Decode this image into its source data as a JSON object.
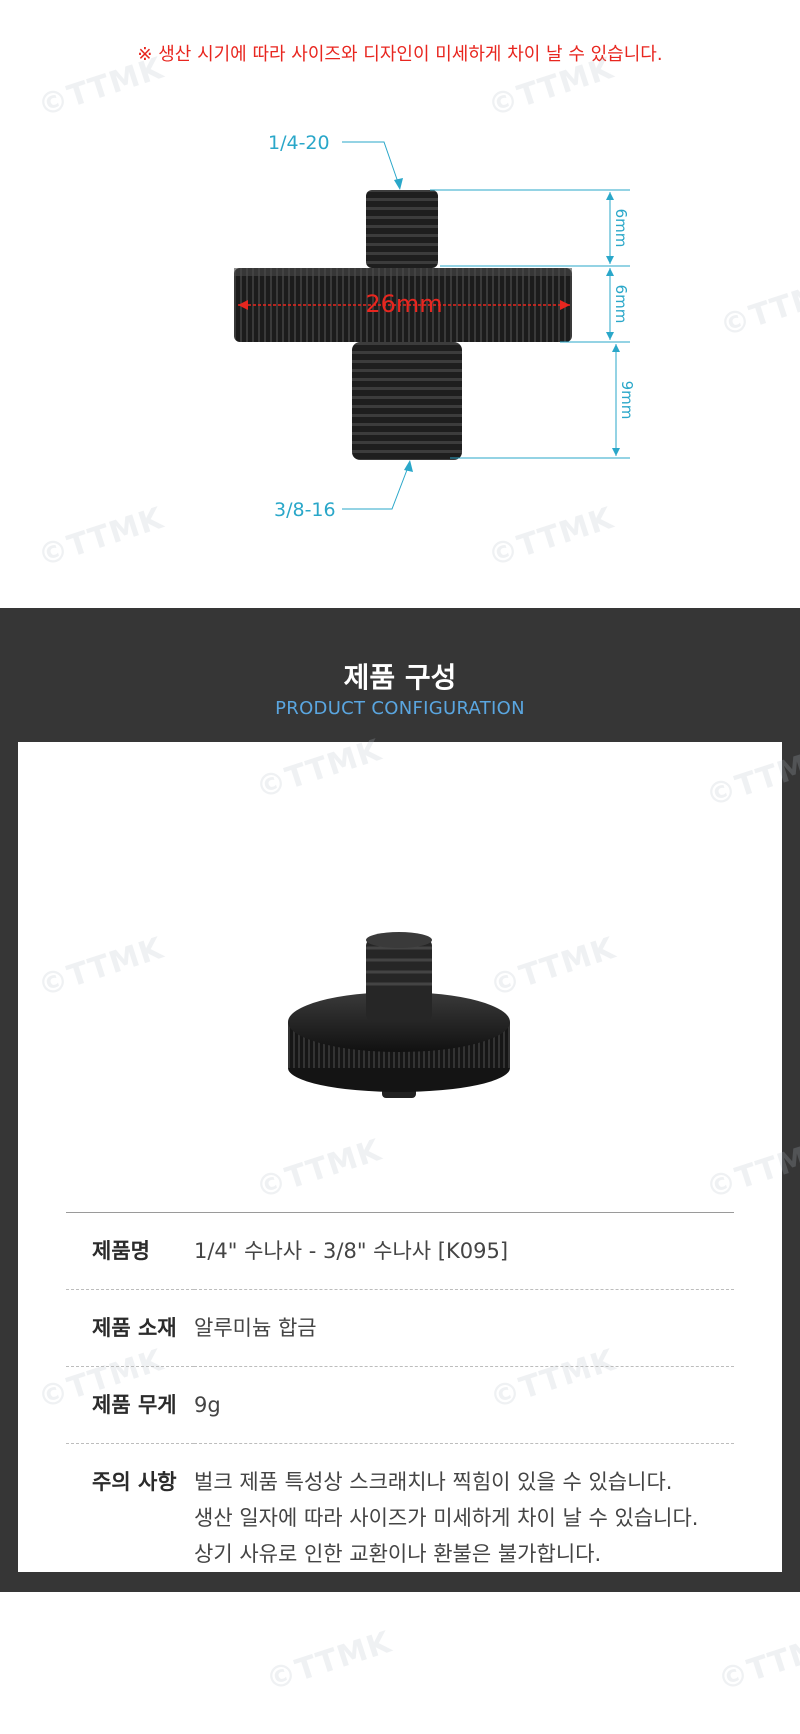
{
  "notice": "※ 생산 시기에 따라 사이즈와 디자인이 미세하게 차이 날 수 있습니다.",
  "watermark": "©TTMK",
  "diagram": {
    "top_thread": "1/4-20",
    "bottom_thread": "3/8-16",
    "diameter": "26mm",
    "dim_top": "6mm",
    "dim_middle": "6mm",
    "dim_bottom": "9mm",
    "accent_color": "#2aa7c9",
    "diameter_color": "#e8261f"
  },
  "section": {
    "title": "제품 구성",
    "subtitle": "PRODUCT CONFIGURATION"
  },
  "specs": [
    {
      "label": "제품명",
      "value": [
        "1/4\" 수나사 - 3/8\" 수나사 [K095]"
      ]
    },
    {
      "label": "제품 소재",
      "value": [
        "알루미늄 합금"
      ]
    },
    {
      "label": "제품 무게",
      "value": [
        "9g"
      ]
    },
    {
      "label": "주의 사항",
      "value": [
        "벌크 제품 특성상 스크래치나 찍힘이 있을 수 있습니다.",
        "생산 일자에 따라 사이즈가 미세하게 차이 날 수 있습니다.",
        "상기 사유로 인한 교환이나 환불은 불가합니다."
      ]
    }
  ]
}
